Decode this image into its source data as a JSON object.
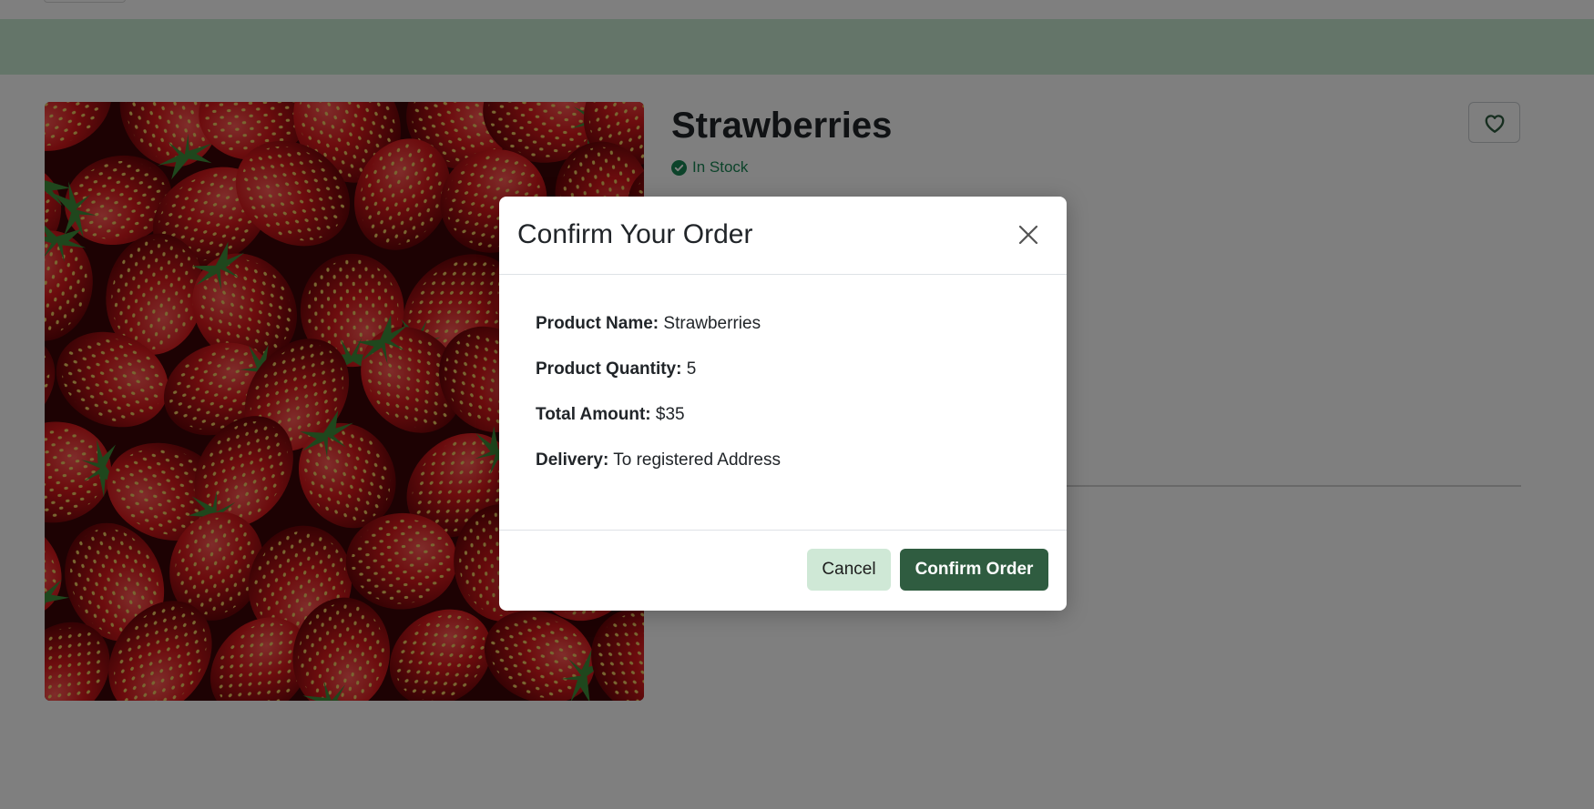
{
  "product": {
    "title": "Strawberries",
    "stock_status": "In Stock",
    "image_subject": "strawberries"
  },
  "icons": {
    "stock": "check-circle-icon",
    "favorite": "heart-icon",
    "close": "close-icon"
  },
  "colors": {
    "navbar": "#c9ead3",
    "stock_green": "#198754",
    "confirm_button": "#2f5c40",
    "cancel_button": "#cfe8d6"
  },
  "modal": {
    "title": "Confirm Your Order",
    "details": [
      {
        "label": "Product Name:",
        "value": "Strawberries"
      },
      {
        "label": "Product Quantity:",
        "value": "5"
      },
      {
        "label": "Total Amount:",
        "value": "$35"
      },
      {
        "label": "Delivery:",
        "value": "To registered Address"
      }
    ],
    "cancel_label": "Cancel",
    "confirm_label": "Confirm Order"
  }
}
